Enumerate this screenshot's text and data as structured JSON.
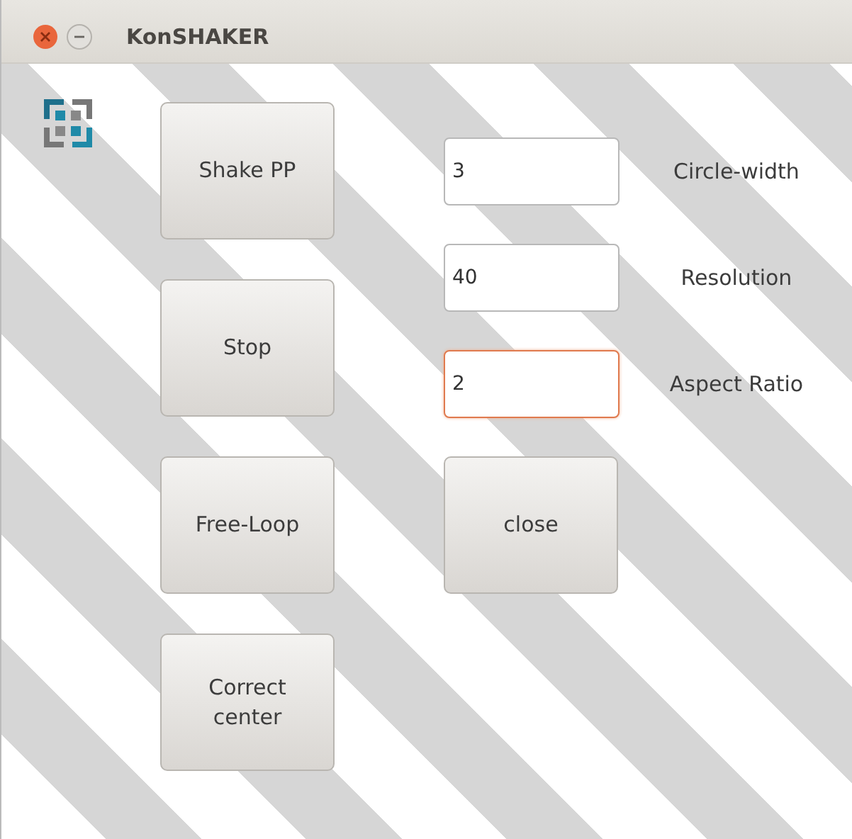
{
  "window": {
    "title": "KonSHAKER"
  },
  "buttons": [
    {
      "label": "Shake PP"
    },
    {
      "label": "Stop"
    },
    {
      "label": "Free-Loop"
    },
    {
      "label": "Correct\ncenter"
    }
  ],
  "fields": [
    {
      "value": "3",
      "label": "Circle-width",
      "focused": false
    },
    {
      "value": "40",
      "label": "Resolution",
      "focused": false
    },
    {
      "value": "2",
      "label": "Aspect Ratio",
      "focused": true
    }
  ],
  "close_button": {
    "label": "close"
  }
}
